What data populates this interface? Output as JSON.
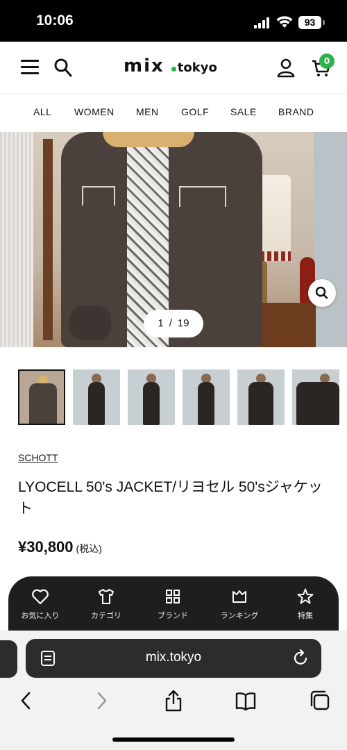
{
  "status_bar": {
    "time": "10:06",
    "battery": "93"
  },
  "header": {
    "logo_main": "mix",
    "logo_tld": "tokyo",
    "cart_count": "0"
  },
  "categories": [
    "ALL",
    "WOMEN",
    "MEN",
    "GOLF",
    "SALE",
    "BRAND"
  ],
  "gallery": {
    "current": "1",
    "separator": "/",
    "total": "19"
  },
  "product": {
    "brand": "SCHOTT",
    "title": "LYOCELL 50's JACKET/リヨセル 50'sジャケット",
    "price": "¥30,800",
    "tax_note": "(税込)"
  },
  "tabbar": {
    "items": [
      {
        "label": "お気に入り",
        "icon": "heart-icon"
      },
      {
        "label": "カテゴリ",
        "icon": "shirt-icon"
      },
      {
        "label": "ブランド",
        "icon": "grid-icon"
      },
      {
        "label": "ランキング",
        "icon": "crown-icon"
      },
      {
        "label": "特集",
        "icon": "star-icon"
      }
    ]
  },
  "browser": {
    "url": "mix.tokyo"
  },
  "colors": {
    "accent_green": "#2bb24c",
    "tabbar_bg": "#1e1e1e"
  }
}
